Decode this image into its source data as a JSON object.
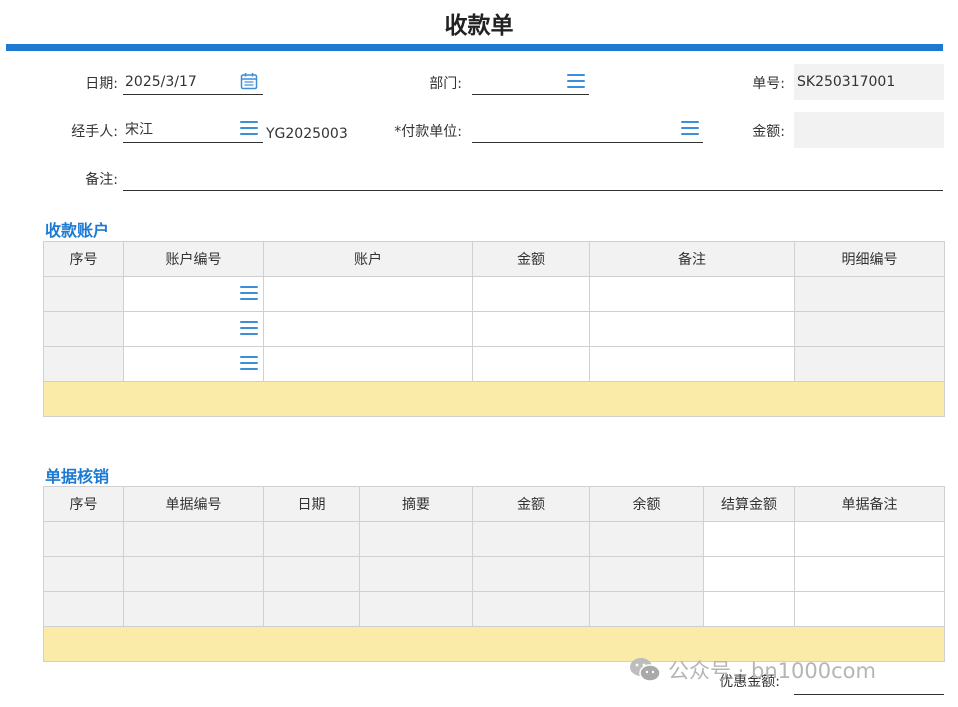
{
  "header": {
    "title": "收款单"
  },
  "form": {
    "date_label": "日期:",
    "date_value": "2025/3/17",
    "dept_label": "部门:",
    "dept_value": "",
    "doc_no_label": "单号:",
    "doc_no_value": "SK250317001",
    "handler_label": "经手人:",
    "handler_value": "宋江",
    "handler_code": "YG2025003",
    "payer_label": "*付款单位:",
    "payer_value": "",
    "amount_label": "金额:",
    "amount_value": "",
    "remark_label": "备注:",
    "remark_value": ""
  },
  "accounts": {
    "title": "收款账户",
    "columns": [
      "序号",
      "账户编号",
      "账户",
      "金额",
      "备注",
      "明细编号"
    ],
    "rows": [
      [
        "",
        "",
        "",
        "",
        "",
        ""
      ],
      [
        "",
        "",
        "",
        "",
        "",
        ""
      ],
      [
        "",
        "",
        "",
        "",
        "",
        ""
      ]
    ]
  },
  "writeoff": {
    "title": "单据核销",
    "columns": [
      "序号",
      "单据编号",
      "日期",
      "摘要",
      "金额",
      "余额",
      "结算金额",
      "单据备注"
    ],
    "rows": [
      [
        "",
        "",
        "",
        "",
        "",
        "",
        "",
        ""
      ],
      [
        "",
        "",
        "",
        "",
        "",
        "",
        "",
        ""
      ],
      [
        "",
        "",
        "",
        "",
        "",
        "",
        "",
        ""
      ]
    ]
  },
  "footer": {
    "discount_label": "优惠金额:",
    "discount_value": ""
  },
  "watermark": {
    "text": "公众号 · bn1000com"
  },
  "colors": {
    "accent": "#1c7ad2",
    "icon": "#3b8fd9",
    "readonly": "#f2f2f2",
    "summary": "#faeba9"
  },
  "icons": {
    "list": "list-icon",
    "calendar": "calendar-icon",
    "wechat": "wechat-icon"
  }
}
